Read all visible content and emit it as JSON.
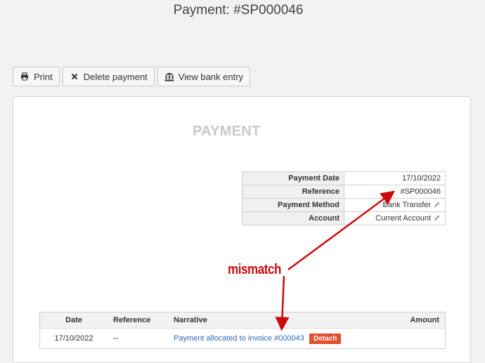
{
  "page": {
    "title": "Payment: #SP000046"
  },
  "toolbar": {
    "print_label": "Print",
    "delete_label": "Delete payment",
    "bank_label": "View bank entry"
  },
  "document": {
    "heading": "PAYMENT",
    "details": [
      {
        "label": "Payment Date",
        "value": "17/10/2022",
        "editable": false
      },
      {
        "label": "Reference",
        "value": "#SP000046",
        "editable": false
      },
      {
        "label": "Payment Method",
        "value": "Bank Transfer",
        "editable": true
      },
      {
        "label": "Account",
        "value": "Current Account",
        "editable": true
      }
    ]
  },
  "allocations": {
    "headers": {
      "date": "Date",
      "reference": "Reference",
      "narrative": "Narrative",
      "amount": "Amount"
    },
    "rows": [
      {
        "date": "17/10/2022",
        "reference": "--",
        "narrative": "Payment allocated to invoice #000043",
        "action": "Detach",
        "amount": ""
      }
    ]
  },
  "annotation": {
    "text": "mismatch",
    "color": "#cc0a0a"
  },
  "colors": {
    "accent_button": "#e0502f",
    "link": "#2a6ab8"
  }
}
